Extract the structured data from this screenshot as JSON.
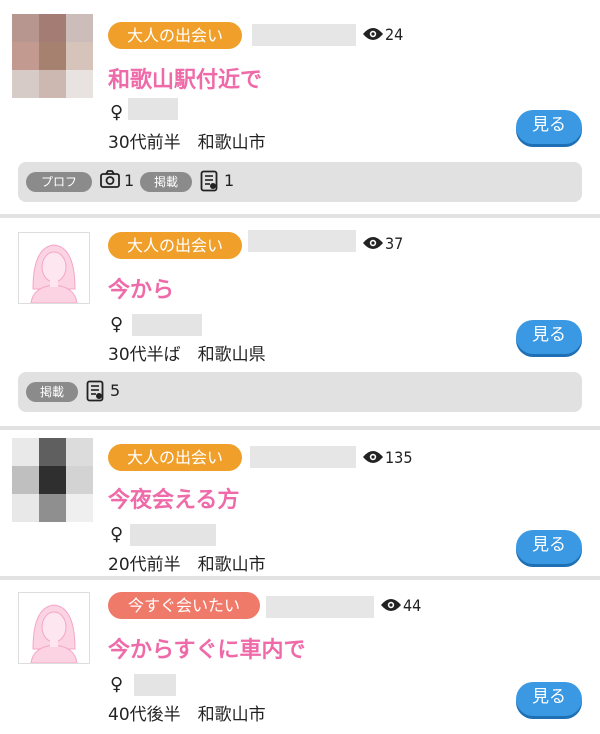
{
  "listings": [
    {
      "avatar": "blurred-photo",
      "category": "大人の出会い",
      "category_color": "#f0a02a",
      "views": "24",
      "title": "和歌山駅付近で",
      "gender_symbol": "♀",
      "info": "30代前半　和歌山市",
      "button_label": "見る",
      "meta": {
        "prof_label": "プロフ",
        "photo_count": "1",
        "post_label": "掲載",
        "post_count": "1"
      }
    },
    {
      "avatar": "female-silhouette",
      "category": "大人の出会い",
      "category_color": "#f0a02a",
      "views": "37",
      "title": "今から",
      "gender_symbol": "♀",
      "info": "30代半ば　和歌山県",
      "button_label": "見る",
      "meta": {
        "post_label": "掲載",
        "post_count": "5"
      }
    },
    {
      "avatar": "blurred-photo",
      "category": "大人の出会い",
      "category_color": "#f0a02a",
      "views": "135",
      "title": "今夜会える方",
      "gender_symbol": "♀",
      "info": "20代前半　和歌山市",
      "button_label": "見る"
    },
    {
      "avatar": "female-silhouette",
      "category": "今すぐ会いたい",
      "category_color": "#f07a6a",
      "views": "44",
      "title": "今からすぐに車内で",
      "gender_symbol": "♀",
      "info": "40代後半　和歌山市",
      "button_label": "見る"
    }
  ],
  "icons": {
    "views": "eye-icon",
    "photo": "camera-icon",
    "post": "document-icon"
  }
}
